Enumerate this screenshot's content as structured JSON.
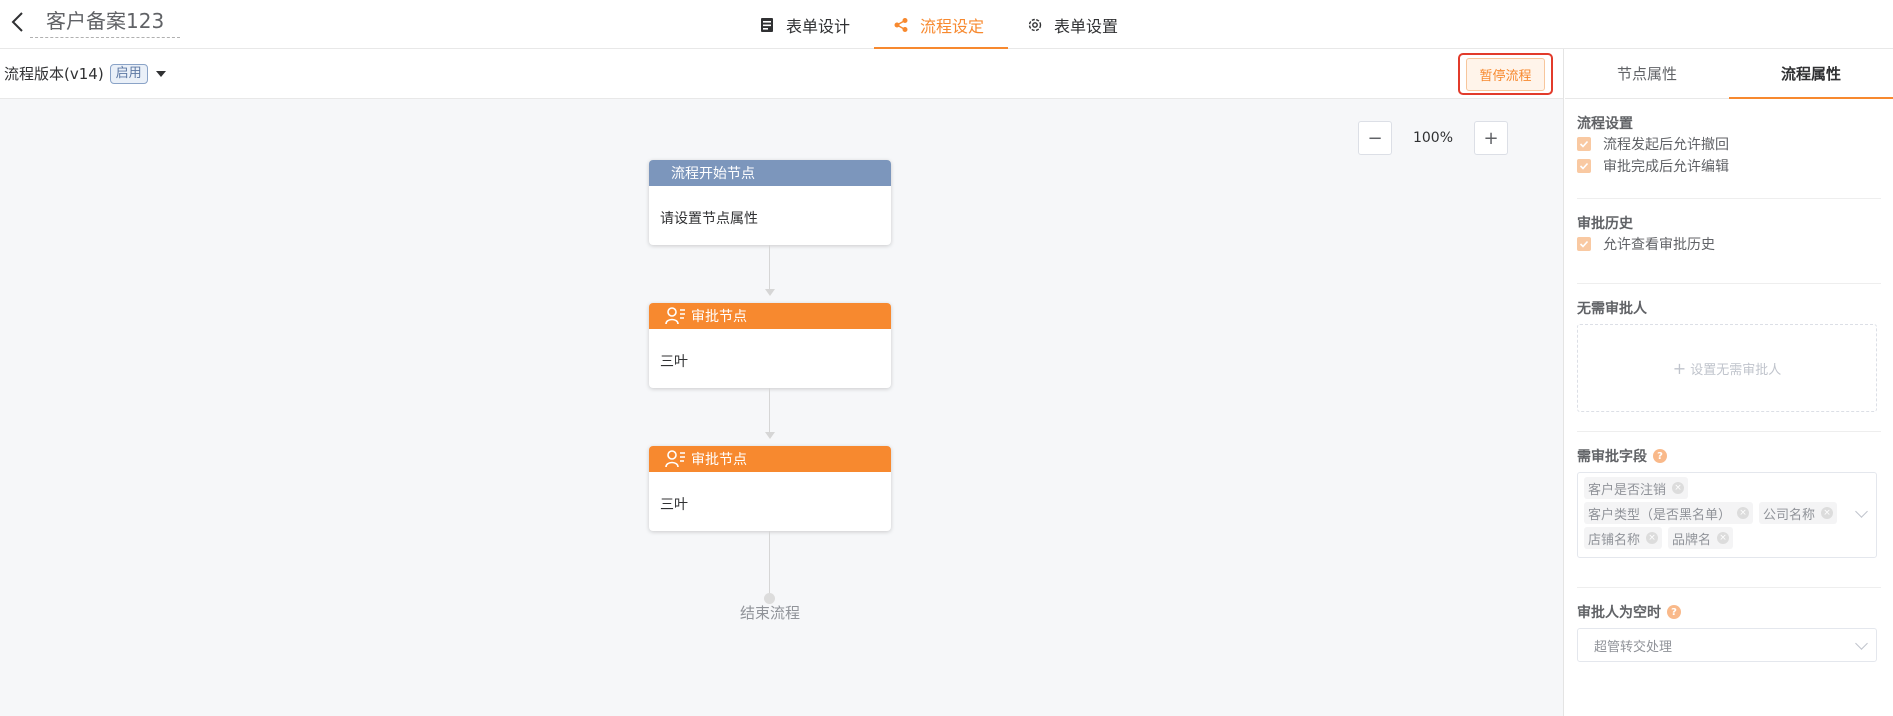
{
  "header": {
    "title": "客户备案123",
    "tabs": [
      {
        "label": "表单设计",
        "icon": "form-icon",
        "active": false
      },
      {
        "label": "流程设定",
        "icon": "flow-icon",
        "active": true
      },
      {
        "label": "表单设置",
        "icon": "gear-icon",
        "active": false
      }
    ]
  },
  "toolbar": {
    "version_label": "流程版本(v14)",
    "status_badge": "启用",
    "pause_button": "暂停流程"
  },
  "zoom": {
    "minus": "−",
    "value": "100%",
    "plus": "+"
  },
  "flow": {
    "nodes": [
      {
        "type": "start",
        "header": "流程开始节点",
        "body": "请设置节点属性"
      },
      {
        "type": "approve",
        "header": "审批节点",
        "body": "三叶"
      },
      {
        "type": "approve",
        "header": "审批节点",
        "body": "三叶"
      }
    ],
    "end_label": "结束流程"
  },
  "panel": {
    "tabs": [
      {
        "label": "节点属性",
        "active": false
      },
      {
        "label": "流程属性",
        "active": true
      }
    ],
    "flow_settings": {
      "title": "流程设置",
      "options": [
        "流程发起后允许撤回",
        "审批完成后允许编辑"
      ]
    },
    "approval_history": {
      "title": "审批历史",
      "options": [
        "允许查看审批历史"
      ]
    },
    "no_approver": {
      "title": "无需审批人",
      "add_label": "设置无需审批人"
    },
    "approval_fields": {
      "title": "需审批字段",
      "rows": [
        [
          "客户是否注销"
        ],
        [
          "客户类型（是否黑名单）",
          "公司名称"
        ],
        [
          "店铺名称",
          "品牌名"
        ]
      ]
    },
    "empty_approver": {
      "title": "审批人为空时",
      "selected": "超管转交处理"
    }
  },
  "colors": {
    "accent": "#f7892f",
    "start_node": "#7c96bc",
    "alert_border": "#e23b2b"
  }
}
